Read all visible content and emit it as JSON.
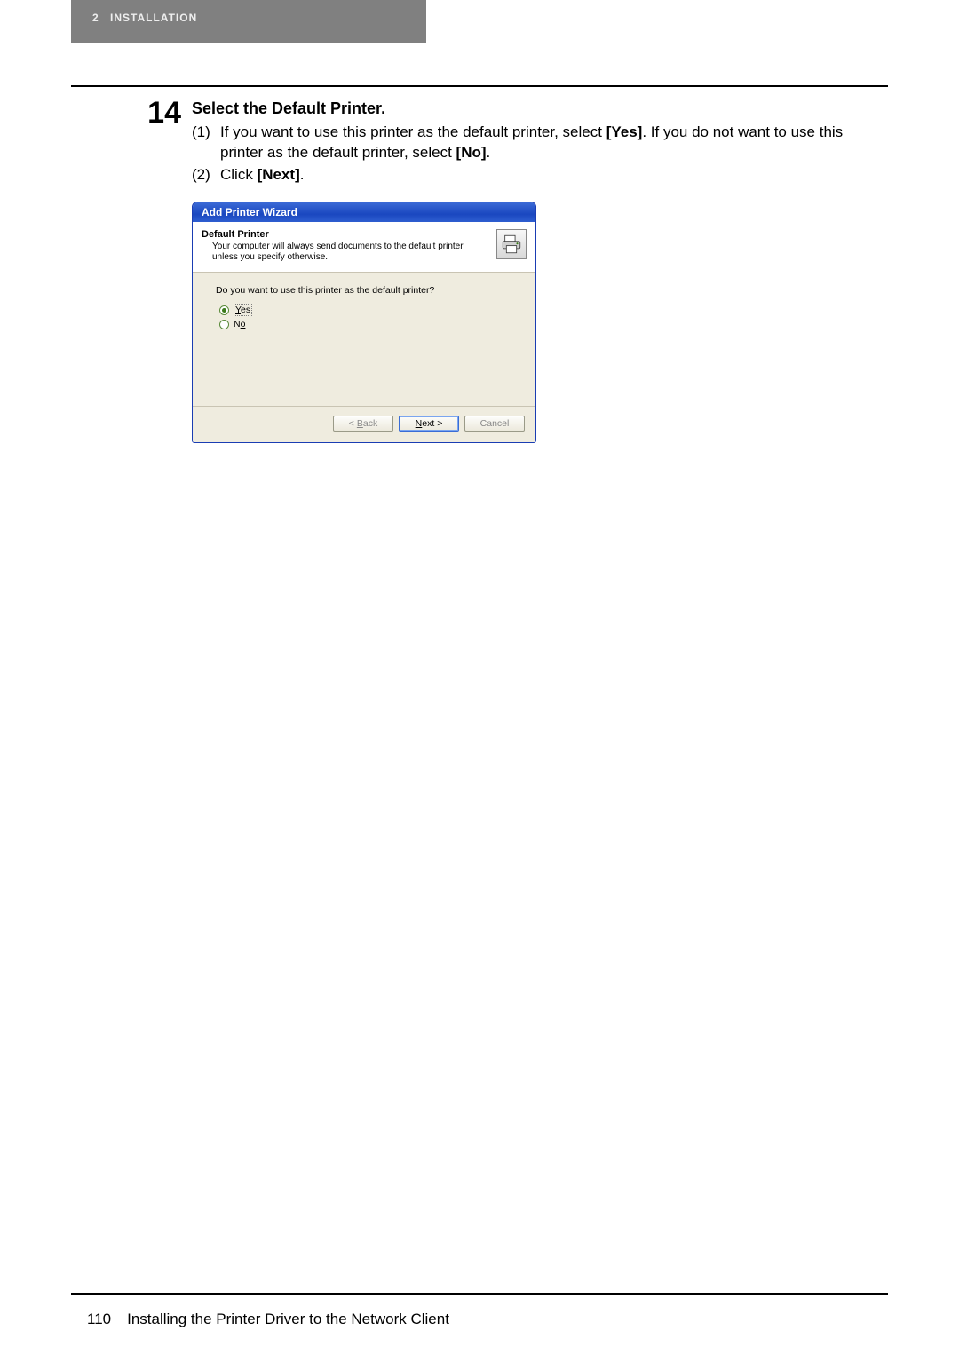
{
  "header": {
    "chapter_num": "2",
    "chapter_title": "INSTALLATION"
  },
  "step": {
    "number": "14",
    "title": "Select the Default Printer.",
    "items": [
      {
        "marker": "(1)",
        "text_before": "If you want to use this printer as the default printer, select ",
        "bold1": "[Yes]",
        "mid": ". If you do not want to use this printer as the default printer, select ",
        "bold2": "[No]",
        "after": "."
      },
      {
        "marker": "(2)",
        "text_before": "Click ",
        "bold1": "[Next]",
        "mid": ".",
        "bold2": "",
        "after": ""
      }
    ]
  },
  "wizard": {
    "title": "Add Printer Wizard",
    "heading": "Default Printer",
    "subheading": "Your computer will always send documents to the default printer unless you specify otherwise.",
    "question": "Do you want to use this printer as the default printer?",
    "options": {
      "yes": "Yes",
      "no": "No"
    },
    "buttons": {
      "back": "< Back",
      "next": "Next >",
      "cancel": "Cancel"
    }
  },
  "footer": {
    "page": "110",
    "title": "Installing the Printer Driver to the Network Client"
  }
}
